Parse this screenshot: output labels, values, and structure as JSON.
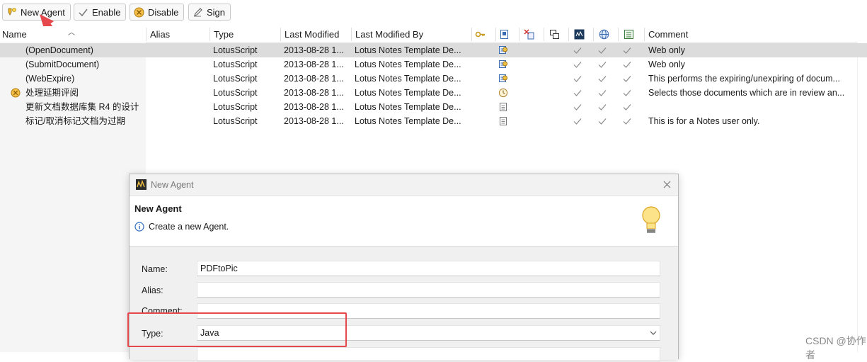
{
  "toolbar": {
    "new_agent": "New Agent",
    "enable": "Enable",
    "disable": "Disable",
    "sign": "Sign"
  },
  "columns": {
    "name": "Name",
    "alias": "Alias",
    "type": "Type",
    "last_modified": "Last Modified",
    "last_modified_by": "Last Modified By",
    "comment": "Comment"
  },
  "rows": [
    {
      "name": "(OpenDocument)",
      "type": "LotusScript",
      "modified": "2013-08-28 1...",
      "modified_by": "Lotus Notes Template De...",
      "trigger": "web-agent-icon",
      "comment": "Web only",
      "selected": true
    },
    {
      "name": "(SubmitDocument)",
      "type": "LotusScript",
      "modified": "2013-08-28 1...",
      "modified_by": "Lotus Notes Template De...",
      "trigger": "web-agent-icon",
      "comment": "Web only",
      "selected": false
    },
    {
      "name": "(WebExpire)",
      "type": "LotusScript",
      "modified": "2013-08-28 1...",
      "modified_by": "Lotus Notes Template De...",
      "trigger": "web-agent-icon",
      "comment": "This performs the expiring/unexpiring of docum...",
      "selected": false
    },
    {
      "name": "处理延期评阅",
      "type": "LotusScript",
      "modified": "2013-08-28 1...",
      "modified_by": "Lotus Notes Template De...",
      "trigger": "clock-icon",
      "comment": "Selects those documents which are in review an...",
      "selected": false,
      "disabled": true
    },
    {
      "name": "更新文档数据库集 R4 的设计",
      "type": "LotusScript",
      "modified": "2013-08-28 1...",
      "modified_by": "Lotus Notes Template De...",
      "trigger": "document-icon",
      "comment": "",
      "selected": false
    },
    {
      "name": "标记/取消标记文档为过期",
      "type": "LotusScript",
      "modified": "2013-08-28 1...",
      "modified_by": "Lotus Notes Template De...",
      "trigger": "document-icon",
      "comment": "This is for a Notes user only.",
      "selected": false
    }
  ],
  "dialog": {
    "window_title": "New Agent",
    "heading": "New Agent",
    "subtitle": "Create a new Agent.",
    "name_label": "Name:",
    "name_value": "PDFtoPic",
    "alias_label": "Alias:",
    "alias_value": "",
    "comment_label": "Comment:",
    "comment_value": "",
    "type_label": "Type:",
    "type_value": "Java"
  },
  "watermark": "CSDN @协作者",
  "colors": {
    "annotation_red": "#e5484d",
    "selected_row": "#dcdcdc"
  }
}
